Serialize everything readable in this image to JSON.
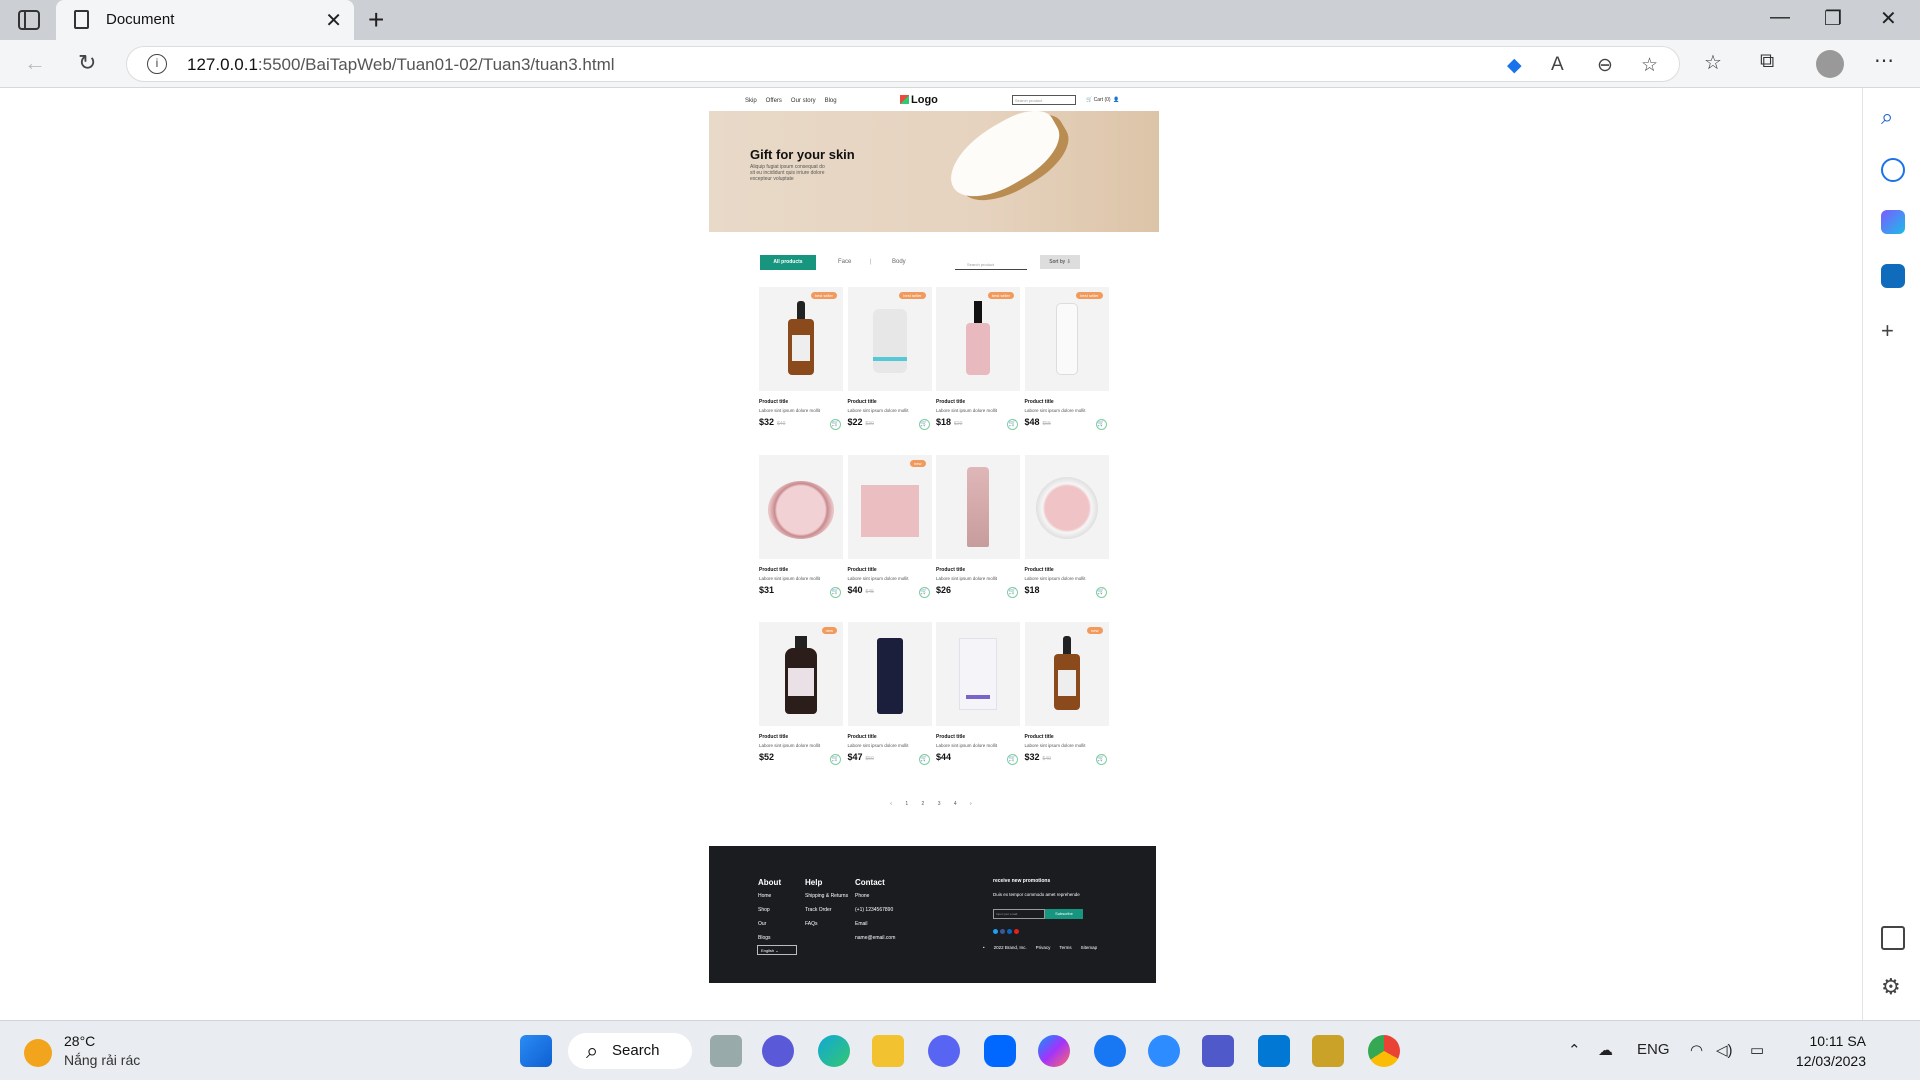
{
  "browser": {
    "tab_title": "Document",
    "url_host": "127.0.0.1",
    "url_path": ":5500/BaiTapWeb/Tuan01-02/Tuan3/tuan3.html"
  },
  "site": {
    "nav": [
      "Skip",
      "Offers",
      "Our story",
      "Blog"
    ],
    "logo": "Logo",
    "search_placeholder": "Search product",
    "cart": "Cart (0)",
    "hero_title": "Gift for your skin",
    "hero_text": "Aliquip fugiat ipsum consequat do sit eu incididunt quis irriure dolore excepteur voluptate",
    "filters": {
      "all": "All products",
      "face": "Face",
      "sep": "|",
      "body": "Body",
      "search_placeholder": "Search product",
      "sort": "Sort by ⇩"
    },
    "products": [
      {
        "title": "Product title",
        "desc": "Labore sint ipsum dolore mollit",
        "price": "$32",
        "old": "$40",
        "badge": "best seller",
        "kind": "amber-dropper"
      },
      {
        "title": "Product title",
        "desc": "Labore sint ipsum dolore mollit",
        "price": "$22",
        "old": "$30",
        "badge": "best seller",
        "kind": "white-tub"
      },
      {
        "title": "Product title",
        "desc": "Labore sint ipsum dolore mollit",
        "price": "$18",
        "old": "$20",
        "badge": "best seller",
        "kind": "pink-dropper"
      },
      {
        "title": "Product title",
        "desc": "Labore sint ipsum dolore mollit",
        "price": "$48",
        "old": "$55",
        "badge": "best seller",
        "kind": "white-bottle"
      },
      {
        "title": "Product title",
        "desc": "Labore sint ipsum dolore mollit",
        "price": "$31",
        "old": "",
        "badge": "",
        "kind": "pink-jar"
      },
      {
        "title": "Product title",
        "desc": "Labore sint ipsum dolore mollit",
        "price": "$40",
        "old": "$45",
        "badge": "new",
        "kind": "pink-box"
      },
      {
        "title": "Product title",
        "desc": "Labore sint ipsum dolore mollit",
        "price": "$26",
        "old": "",
        "badge": "",
        "kind": "pink-tube"
      },
      {
        "title": "Product title",
        "desc": "Labore sint ipsum dolore mollit",
        "price": "$18",
        "old": "",
        "badge": "",
        "kind": "pink-cream"
      },
      {
        "title": "Product title",
        "desc": "Labore sint ipsum dolore mollit",
        "price": "$52",
        "old": "",
        "badge": "new",
        "kind": "dark-bottle"
      },
      {
        "title": "Product title",
        "desc": "Labore sint ipsum dolore mollit",
        "price": "$47",
        "old": "$50",
        "badge": "",
        "kind": "navy-tube"
      },
      {
        "title": "Product title",
        "desc": "Labore sint ipsum dolore mollit",
        "price": "$44",
        "old": "",
        "badge": "",
        "kind": "white-box"
      },
      {
        "title": "Product title",
        "desc": "Labore sint ipsum dolore mollit",
        "price": "$32",
        "old": "$40",
        "badge": "new",
        "kind": "amber-dropper"
      }
    ],
    "pager": "‹ 1 2 3 4 ›",
    "footer": {
      "about": {
        "title": "About",
        "items": [
          "Home",
          "Shop",
          "Our",
          "Blogs"
        ]
      },
      "help": {
        "title": "Help",
        "items": [
          "Shipping & Returns",
          "Track Order",
          "FAQs"
        ]
      },
      "contact": {
        "title": "Contact",
        "items": [
          "Phone",
          "(+1) 1234567890",
          "Email",
          "name@email.com"
        ]
      },
      "lang": "English",
      "promo_title": "receive new promotions",
      "promo_text": "Duis ex tempor commodo amet reprehende",
      "promo_input": "Input your email",
      "promo_button": "Subscribe",
      "legal": [
        "•",
        "2022 Brand, Inc.",
        "Privacy",
        "Terms",
        "Sitemap"
      ]
    }
  },
  "taskbar": {
    "temp": "28°C",
    "condition": "Nắng rải rác",
    "search": "Search",
    "lang": "ENG",
    "time": "10:11 SA",
    "date": "12/03/2023"
  }
}
